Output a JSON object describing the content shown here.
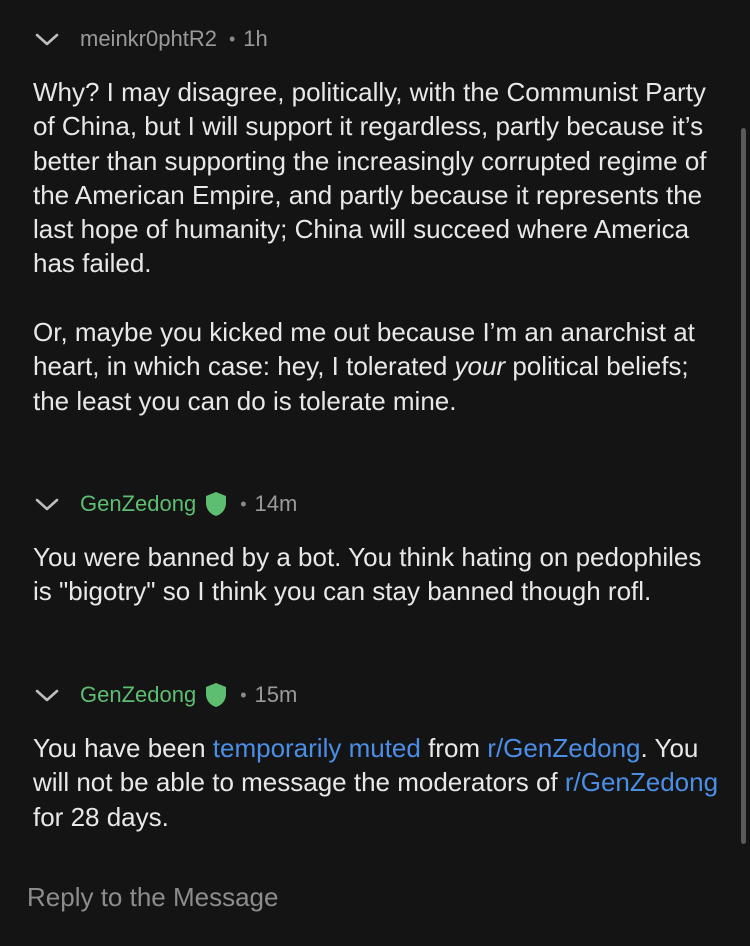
{
  "messages": [
    {
      "author": "meinkr0phtR2",
      "sep": "•",
      "time": "1h",
      "body": {
        "p1": "Why? I may disagree, politically, with the Communist Party of China, but I will support it regardless, partly because it’s better than supporting the increasingly corrupted regime of the American Empire, and partly because it represents the last hope of humanity; China will succeed where America has failed.",
        "p2_a": "Or, maybe you kicked me out because I’m an anarchist at heart, in which case: hey, I tolerated ",
        "p2_em": "your",
        "p2_b": " political beliefs; the least you can do is tolerate mine."
      }
    },
    {
      "author": "GenZedong",
      "sep": "•",
      "time": "14m",
      "body": {
        "p1": "You were banned by a bot. You think hating on pedophiles is \"bigotry\" so I think you can stay banned though rofl."
      }
    },
    {
      "author": "GenZedong",
      "sep": "•",
      "time": "15m",
      "body": {
        "t1": "You have been ",
        "link1": "temporarily muted",
        "t2": " from ",
        "link2": "r/GenZedong",
        "t3": ". You will not be able to message the moderators of ",
        "link3": "r/GenZedong",
        "t4": " for 28 days."
      }
    }
  ],
  "reply_placeholder": "Reply to the Message",
  "icons": {
    "collapse": "chevron-down-icon",
    "mod": "mod-shield-icon"
  },
  "colors": {
    "background": "#141414",
    "text": "#e8e8e8",
    "meta": "#9a9a9a",
    "mod_green": "#5dbe72",
    "link_blue": "#4b8ee6"
  }
}
